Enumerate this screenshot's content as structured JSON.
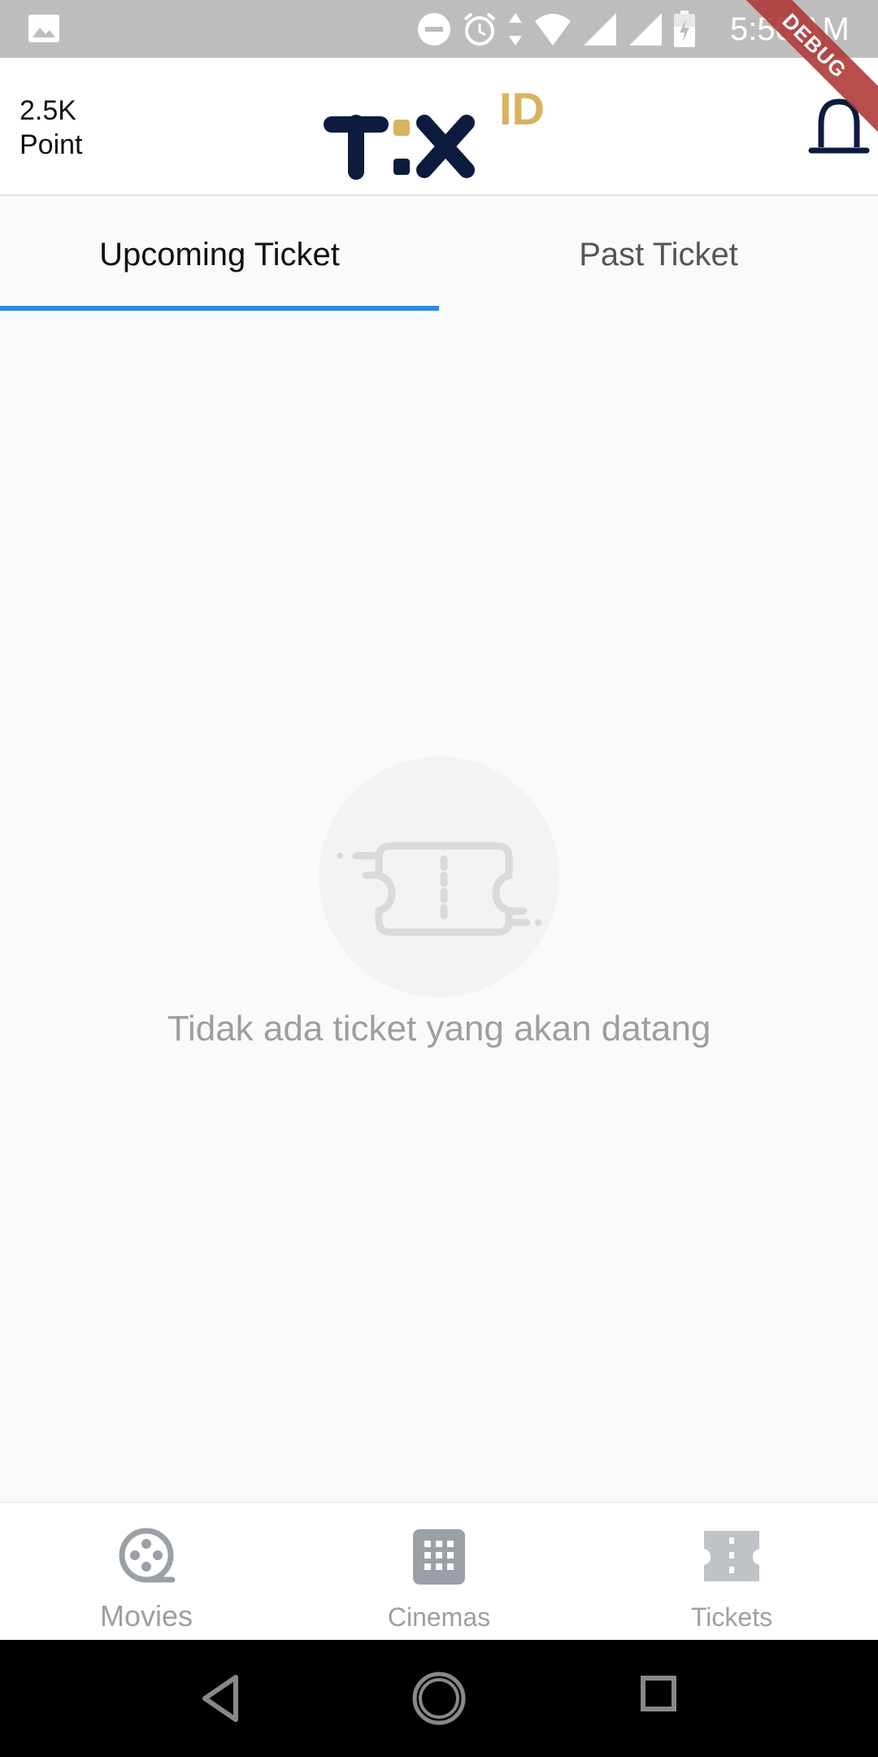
{
  "status_bar": {
    "time": "5:50 AM",
    "icons": [
      "image-icon",
      "do-not-disturb-icon",
      "alarm-icon",
      "data-arrows-icon",
      "wifi-icon",
      "signal-icon",
      "signal-icon",
      "battery-charging-icon"
    ]
  },
  "debug_banner": {
    "label": "DEBUG"
  },
  "header": {
    "points_value": "2.5K",
    "points_label": "Point",
    "logo_text": "TIX",
    "logo_suffix": "ID",
    "logo_color": "#0d1b3e",
    "logo_accent": "#d9b25f"
  },
  "tabs": {
    "items": [
      {
        "label": "Upcoming Ticket",
        "active": true
      },
      {
        "label": "Past Ticket",
        "active": false
      }
    ],
    "indicator_color": "#2b8ae0"
  },
  "empty_state": {
    "message": "Tidak ada ticket yang akan datang",
    "icon": "ticket-icon"
  },
  "bottom_nav": {
    "items": [
      {
        "label": "Movies",
        "icon": "film-reel-icon"
      },
      {
        "label": "Cinemas",
        "icon": "building-icon"
      },
      {
        "label": "Tickets",
        "icon": "ticket-icon"
      }
    ]
  },
  "system_nav": {
    "buttons": [
      "back-icon",
      "home-icon",
      "recents-icon"
    ]
  }
}
